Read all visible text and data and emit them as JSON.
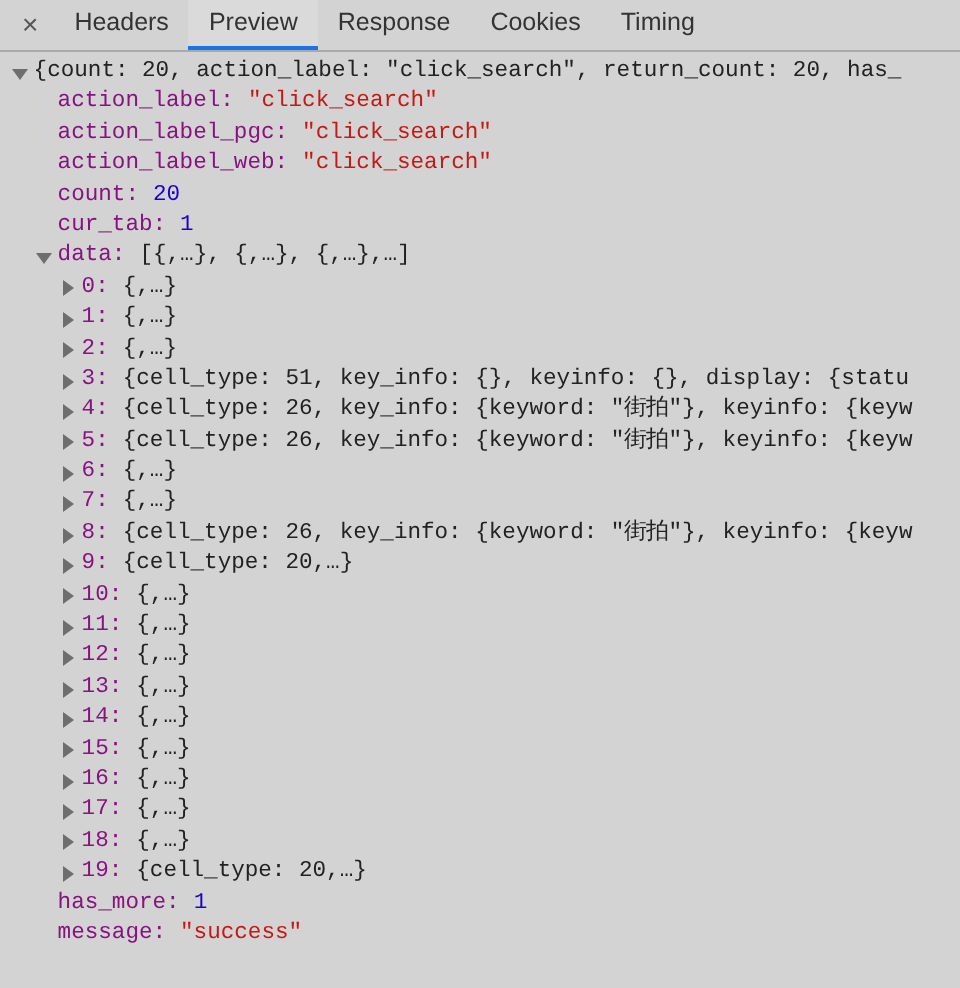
{
  "close": "×",
  "tabs": [
    {
      "label": "Headers",
      "selected": false
    },
    {
      "label": "Preview",
      "selected": true
    },
    {
      "label": "Response",
      "selected": false
    },
    {
      "label": "Cookies",
      "selected": false
    },
    {
      "label": "Timing",
      "selected": false
    }
  ],
  "tree": {
    "expanded": true,
    "preview": "{count: 20, action_label: \"click_search\", return_count: 20, has_",
    "children": [
      {
        "key": "action_label:",
        "value": "\"click_search\"",
        "kind": "string"
      },
      {
        "key": "action_label_pgc:",
        "value": "\"click_search\"",
        "kind": "string"
      },
      {
        "key": "action_label_web:",
        "value": "\"click_search\"",
        "kind": "string"
      },
      {
        "key": "count:",
        "value": "20",
        "kind": "number"
      },
      {
        "key": "cur_tab:",
        "value": "1",
        "kind": "number"
      },
      {
        "key": "data:",
        "value": "[{,…}, {,…}, {,…},…]",
        "kind": "object",
        "expanded": true,
        "children": [
          {
            "key": "0:",
            "value": "{,…}",
            "kind": "object",
            "expanded": false
          },
          {
            "key": "1:",
            "value": "{,…}",
            "kind": "object",
            "expanded": false
          },
          {
            "key": "2:",
            "value": "{,…}",
            "kind": "object",
            "expanded": false
          },
          {
            "key": "3:",
            "value": "{cell_type: 51, key_info: {}, keyinfo: {}, display: {statu",
            "kind": "object",
            "expanded": false
          },
          {
            "key": "4:",
            "value": "{cell_type: 26, key_info: {keyword: \"街拍\"}, keyinfo: {keyw",
            "kind": "object",
            "expanded": false
          },
          {
            "key": "5:",
            "value": "{cell_type: 26, key_info: {keyword: \"街拍\"}, keyinfo: {keyw",
            "kind": "object",
            "expanded": false
          },
          {
            "key": "6:",
            "value": "{,…}",
            "kind": "object",
            "expanded": false
          },
          {
            "key": "7:",
            "value": "{,…}",
            "kind": "object",
            "expanded": false
          },
          {
            "key": "8:",
            "value": "{cell_type: 26, key_info: {keyword: \"街拍\"}, keyinfo: {keyw",
            "kind": "object",
            "expanded": false
          },
          {
            "key": "9:",
            "value": "{cell_type: 20,…}",
            "kind": "object",
            "expanded": false
          },
          {
            "key": "10:",
            "value": "{,…}",
            "kind": "object",
            "expanded": false
          },
          {
            "key": "11:",
            "value": "{,…}",
            "kind": "object",
            "expanded": false
          },
          {
            "key": "12:",
            "value": "{,…}",
            "kind": "object",
            "expanded": false
          },
          {
            "key": "13:",
            "value": "{,…}",
            "kind": "object",
            "expanded": false
          },
          {
            "key": "14:",
            "value": "{,…}",
            "kind": "object",
            "expanded": false
          },
          {
            "key": "15:",
            "value": "{,…}",
            "kind": "object",
            "expanded": false
          },
          {
            "key": "16:",
            "value": "{,…}",
            "kind": "object",
            "expanded": false
          },
          {
            "key": "17:",
            "value": "{,…}",
            "kind": "object",
            "expanded": false
          },
          {
            "key": "18:",
            "value": "{,…}",
            "kind": "object",
            "expanded": false
          },
          {
            "key": "19:",
            "value": "{cell_type: 20,…}",
            "kind": "object",
            "expanded": false
          }
        ]
      },
      {
        "key": "has_more:",
        "value": "1",
        "kind": "number"
      },
      {
        "key": "message:",
        "value": "\"success\"",
        "kind": "string"
      }
    ]
  }
}
